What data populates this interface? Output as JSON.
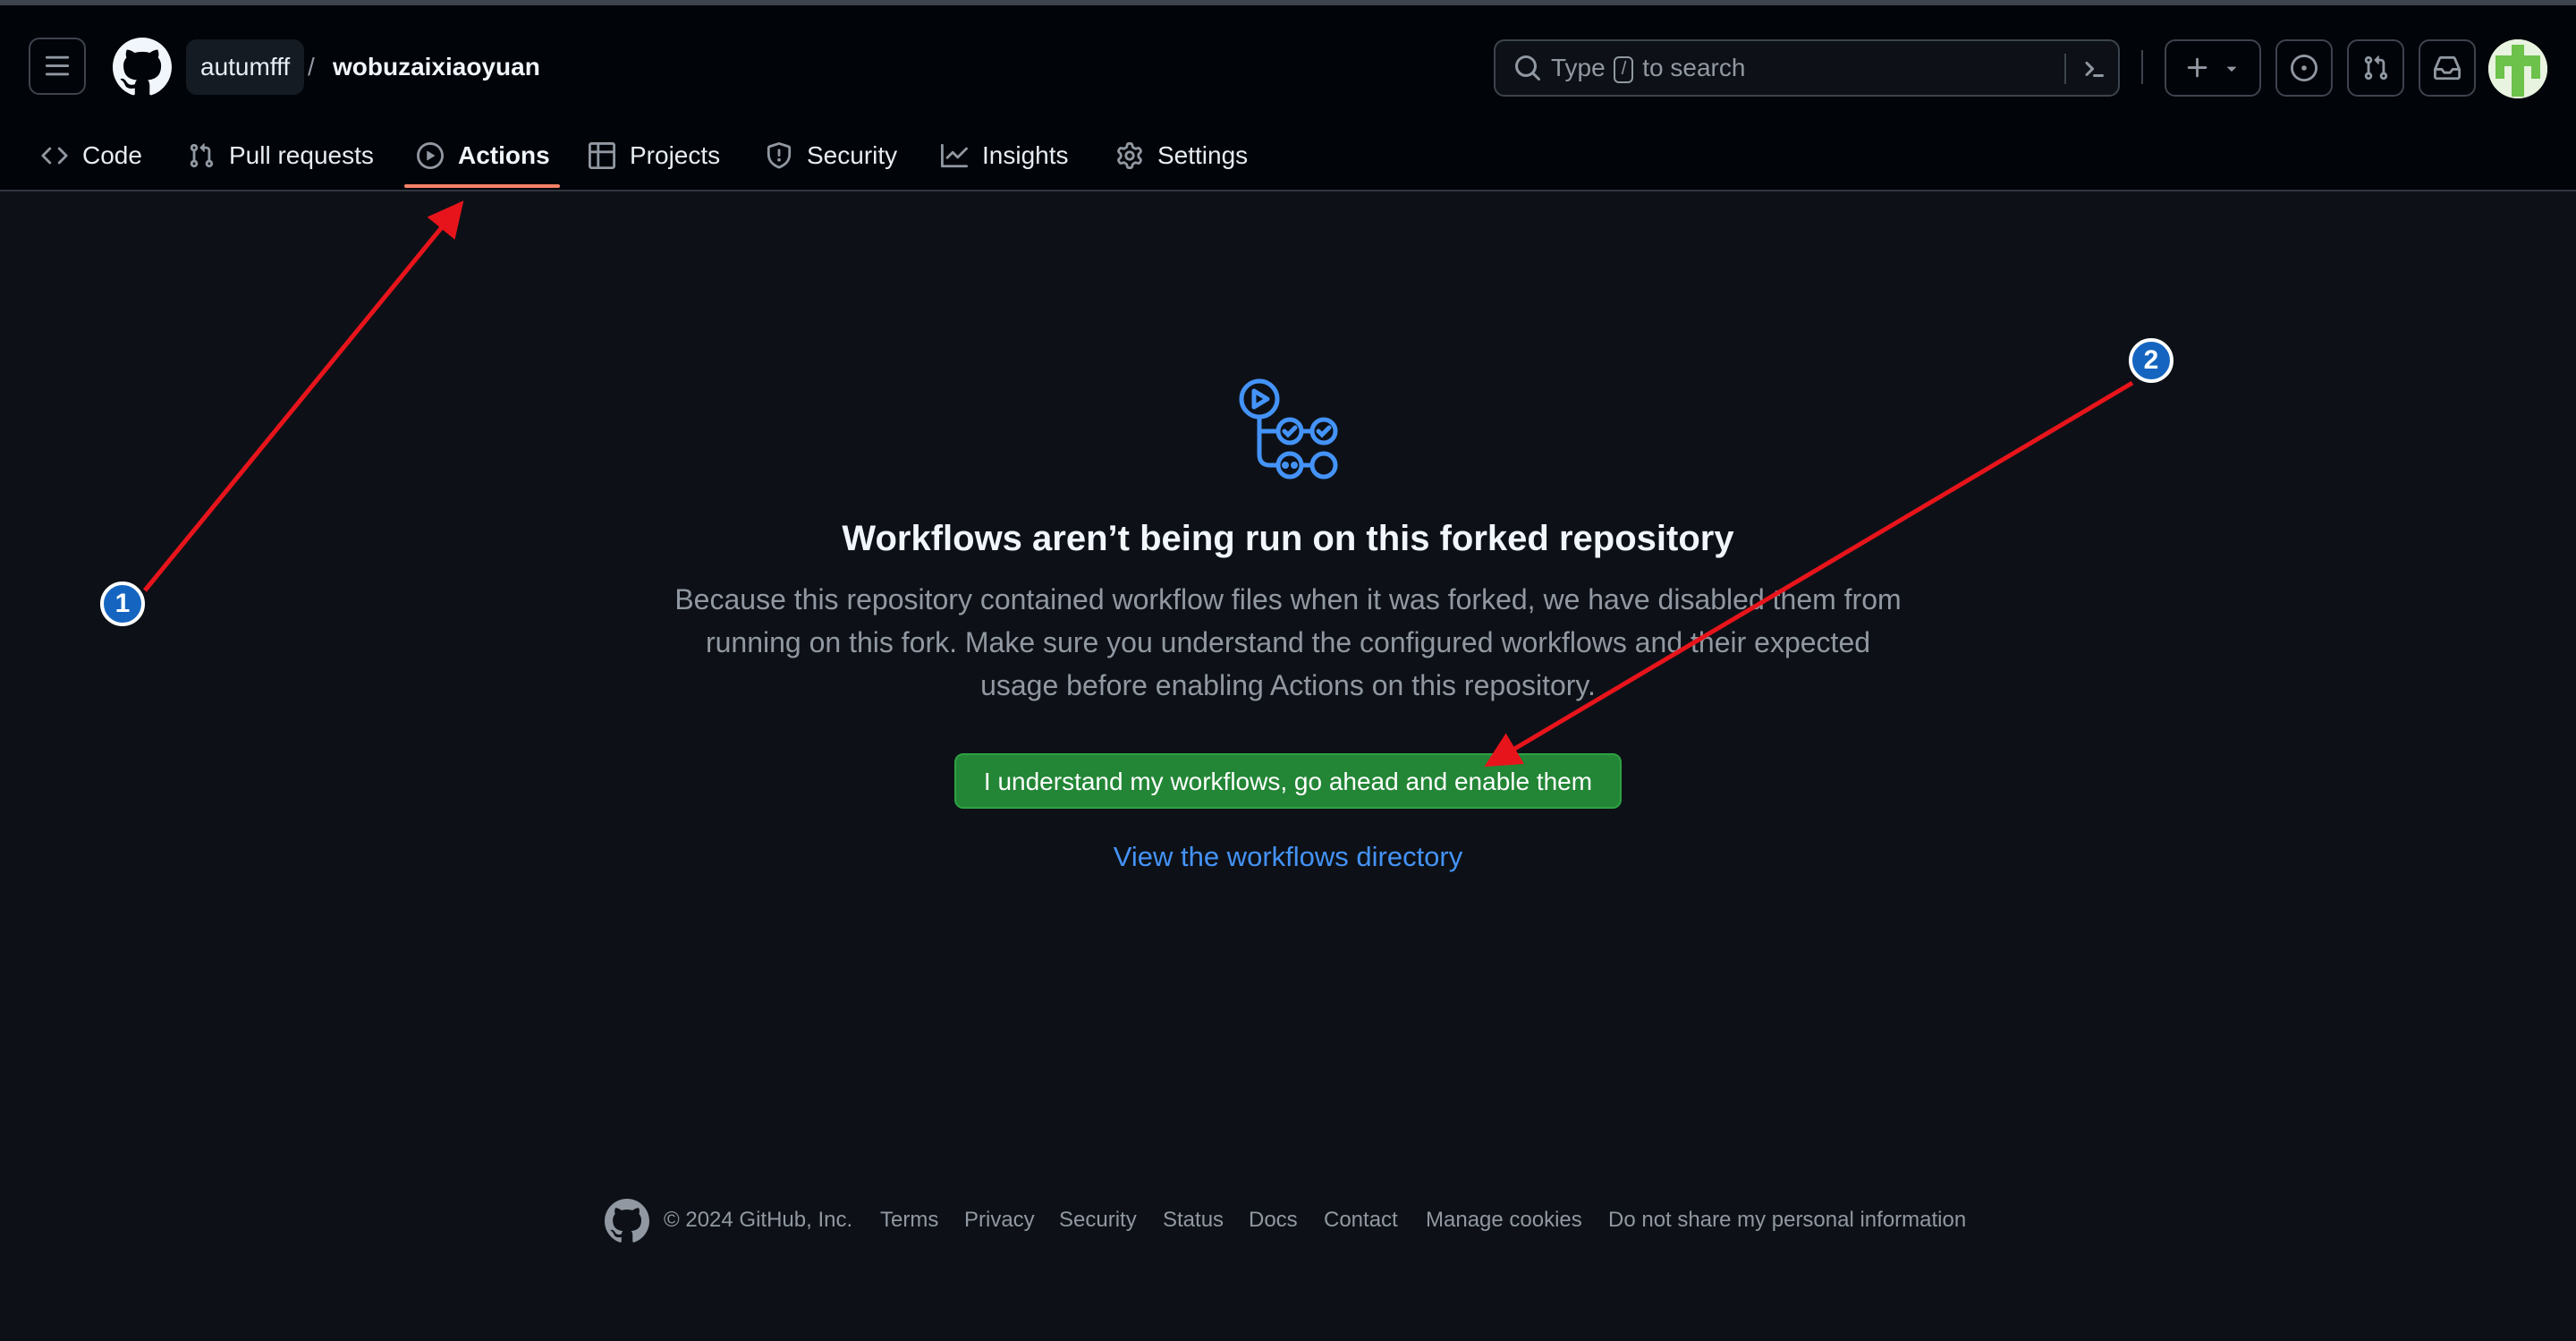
{
  "header": {
    "owner": "autumfff",
    "separator": "/",
    "repo": "wobuzaixiaoyuan",
    "search": {
      "prefix": "Type",
      "key": "/",
      "suffix": "to search"
    },
    "icons": {
      "menu": "hamburger-icon",
      "logo": "github-logo",
      "search": "search-icon",
      "command": "command-palette-icon",
      "create": "plus-icon",
      "issues": "issue-opened-icon",
      "pulls": "git-pull-request-icon",
      "inbox": "inbox-icon"
    }
  },
  "tabs": [
    {
      "label": "Code",
      "icon": "code-icon"
    },
    {
      "label": "Pull requests",
      "icon": "git-pull-request-icon"
    },
    {
      "label": "Actions",
      "icon": "play-icon",
      "active": true
    },
    {
      "label": "Projects",
      "icon": "table-icon"
    },
    {
      "label": "Security",
      "icon": "shield-icon"
    },
    {
      "label": "Insights",
      "icon": "graph-icon"
    },
    {
      "label": "Settings",
      "icon": "gear-icon"
    }
  ],
  "main": {
    "icon": "workflow-icon",
    "heading": "Workflows aren’t being run on this forked repository",
    "description_lines": [
      "Because this repository contained workflow files when it was forked, we have disabled them from",
      "running on this fork. Make sure you understand the configured workflows and their expected",
      "usage before enabling Actions on this repository."
    ],
    "enable_button": "I understand my workflows, go ahead and enable them",
    "directory_link": "View the workflows directory"
  },
  "footer": {
    "copyright": "© 2024 GitHub, Inc.",
    "links": [
      "Terms",
      "Privacy",
      "Security",
      "Status",
      "Docs",
      "Contact",
      "Manage cookies",
      "Do not share my personal information"
    ]
  },
  "annotations": [
    {
      "number": "1"
    },
    {
      "number": "2"
    }
  ],
  "colors": {
    "background": "#0d1117",
    "header": "#010409",
    "accent_underline": "#f78166",
    "primary_button": "#238636",
    "link": "#4493f8",
    "annotation_arrow": "#e8141b",
    "annotation_badge": "#1565c0"
  }
}
